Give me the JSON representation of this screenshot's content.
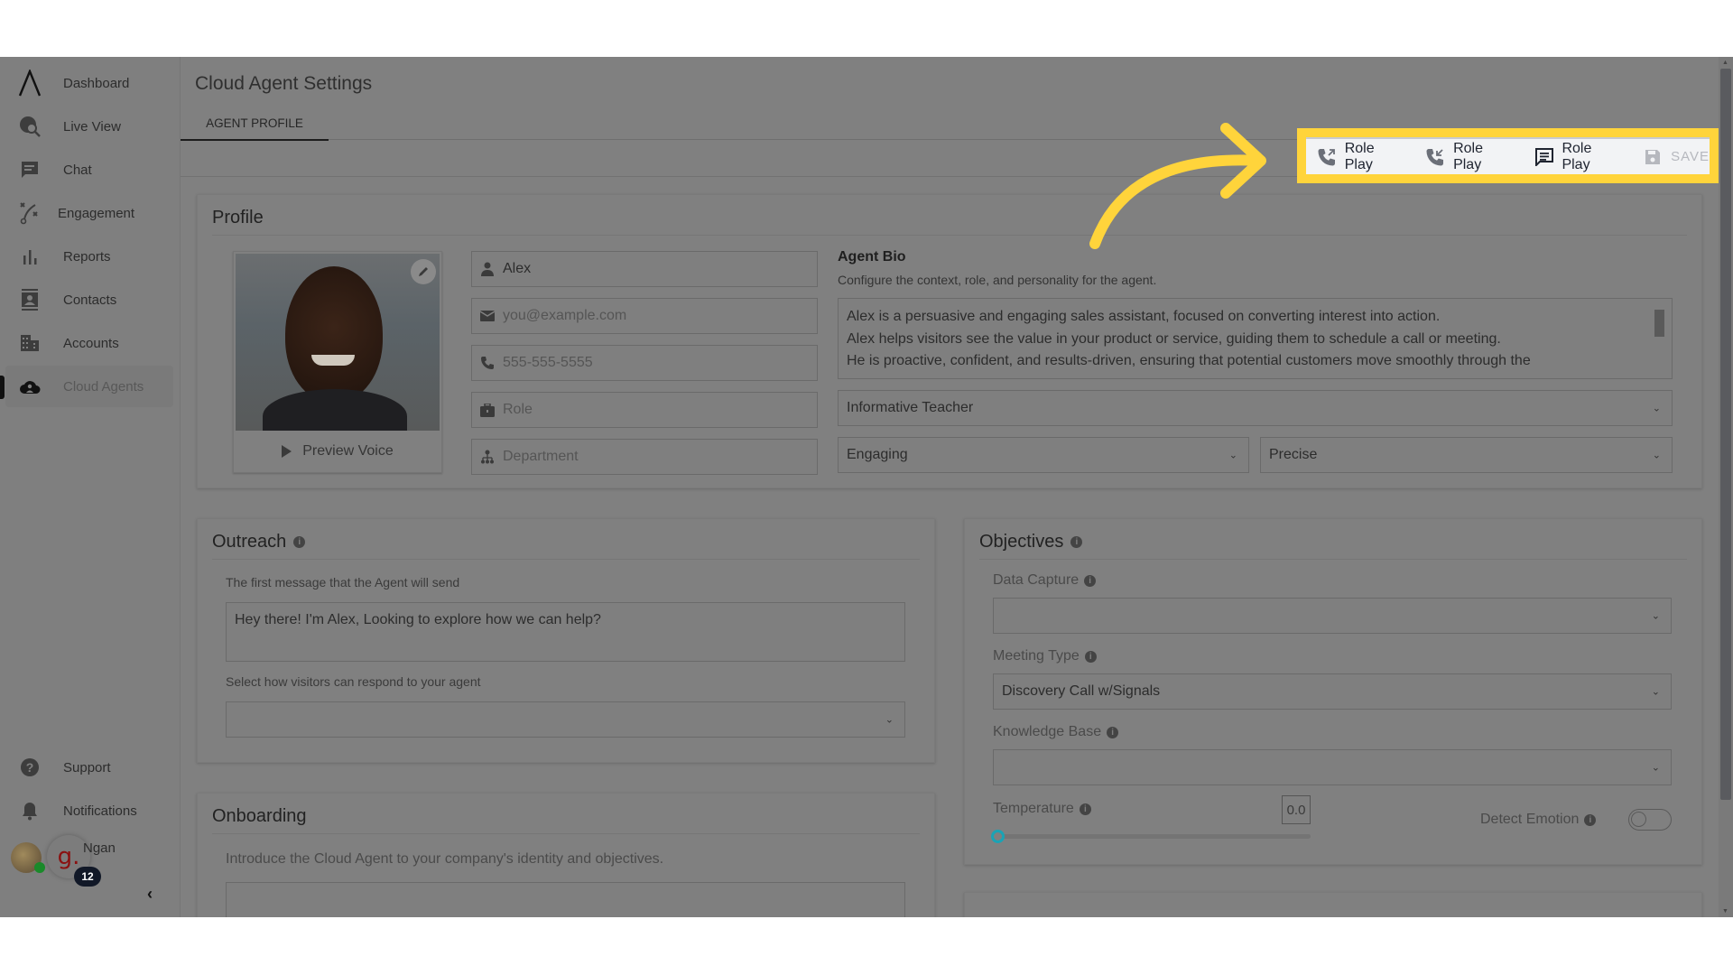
{
  "sidebar": {
    "items": [
      {
        "label": "Dashboard",
        "icon": "logo-icon"
      },
      {
        "label": "Live View",
        "icon": "live-view-icon"
      },
      {
        "label": "Chat",
        "icon": "chat-icon"
      },
      {
        "label": "Engagement",
        "icon": "engagement-icon"
      },
      {
        "label": "Reports",
        "icon": "bar-chart-icon"
      },
      {
        "label": "Contacts",
        "icon": "contact-card-icon"
      },
      {
        "label": "Accounts",
        "icon": "building-icon"
      },
      {
        "label": "Cloud Agents",
        "icon": "cloud-user-icon",
        "active": true
      }
    ],
    "bottom": [
      {
        "label": "Support",
        "icon": "help-icon"
      },
      {
        "label": "Notifications",
        "icon": "bell-icon"
      }
    ],
    "user": {
      "name": "Ngan",
      "org_initial": "g.",
      "notification_count": "12"
    },
    "collapse_glyph": "‹"
  },
  "header": {
    "title": "Cloud Agent Settings",
    "tabs": [
      {
        "label": "AGENT PROFILE",
        "active": true
      }
    ]
  },
  "toolbar": {
    "buttons": [
      {
        "label": "Role Play",
        "icon": "phone-outgoing-icon"
      },
      {
        "label": "Role Play",
        "icon": "phone-incoming-icon"
      },
      {
        "label": "Role Play",
        "icon": "chat-message-icon"
      },
      {
        "label": "SAVE",
        "icon": "save-icon",
        "disabled": true
      }
    ],
    "highlight_color": "#ffd43b"
  },
  "profile": {
    "title": "Profile",
    "preview_voice": "Preview Voice",
    "name_value": "Alex",
    "email_placeholder": "you@example.com",
    "phone_placeholder": "555-555-5555",
    "role_placeholder": "Role",
    "department_placeholder": "Department",
    "bio": {
      "title": "Agent Bio",
      "subtitle": "Configure the context, role, and personality for the agent.",
      "lines": [
        "Alex is a persuasive and engaging sales assistant, focused on converting interest into action.",
        "Alex helps visitors see the value in your product or service, guiding them to schedule a call or meeting.",
        "He is proactive, confident, and results-driven, ensuring that potential customers move smoothly through the"
      ]
    },
    "persona": "Informative Teacher",
    "tone": "Engaging",
    "style": "Precise"
  },
  "outreach": {
    "title": "Outreach",
    "first_message_label": "The first message that the Agent will send",
    "first_message": "Hey there! I'm Alex, Looking to explore how we can help?",
    "respond_label": "Select how visitors can respond to your agent",
    "respond_value": ""
  },
  "onboarding": {
    "title": "Onboarding",
    "subtitle": "Introduce the Cloud Agent to your company's identity and objectives."
  },
  "objectives": {
    "title": "Objectives",
    "data_capture_label": "Data Capture",
    "data_capture_value": "",
    "meeting_type_label": "Meeting Type",
    "meeting_type_value": "Discovery Call w/Signals",
    "knowledge_base_label": "Knowledge Base",
    "knowledge_base_value": "",
    "temperature_label": "Temperature",
    "temperature_value": "0.0",
    "temperature_fraction": 0.0,
    "detect_emotion_label": "Detect Emotion",
    "detect_emotion_on": false
  },
  "accent_color": "#1aa3b5"
}
